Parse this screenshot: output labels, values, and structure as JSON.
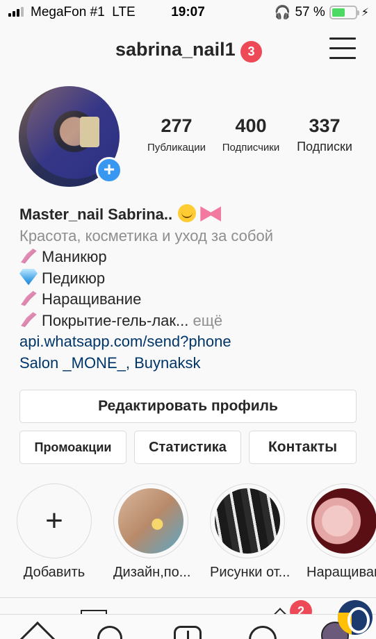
{
  "status_bar": {
    "carrier": "MegaFon #1",
    "network": "LTE",
    "time": "19:07",
    "battery": "57 %",
    "battery_level": 0.57
  },
  "header": {
    "username": "sabrina_nail1",
    "notifications_count": "3"
  },
  "stats": [
    {
      "value": "277",
      "label": "Публикации"
    },
    {
      "value": "400",
      "label": "Подписчики"
    },
    {
      "value": "337",
      "label": "Подписки"
    }
  ],
  "bio": {
    "name": "Master_nail Sabrina..",
    "category": "Красота, косметика и уход за собой",
    "lines": [
      "Маникюр",
      "Педикюр",
      "Наращивание",
      "Покрытие-гель-лак..."
    ],
    "more": "ещё",
    "link": "api.whatsapp.com/send?phone",
    "location": "Salon _MONE_, Buynaksk"
  },
  "buttons": {
    "edit_profile": "Редактировать профиль",
    "promotions": "Промоакции",
    "statistics": "Статистика",
    "contacts": "Контакты"
  },
  "highlights": [
    {
      "label": "Добавить"
    },
    {
      "label": "Дизайн,по..."
    },
    {
      "label": "Рисунки от..."
    },
    {
      "label": "Наращиван"
    }
  ],
  "tags_badge": "2",
  "colors": {
    "accent": "#3897f0",
    "badge": "#ed4956",
    "link": "#003569",
    "muted": "#8e8e8e"
  }
}
